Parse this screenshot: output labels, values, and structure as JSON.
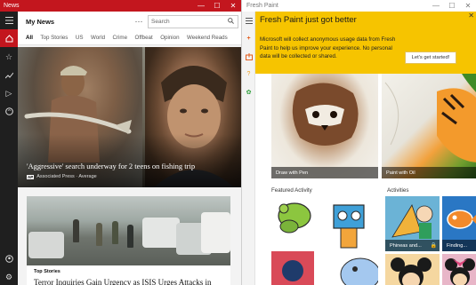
{
  "news_window": {
    "title": "News",
    "controls": {
      "minimize": "—",
      "maximize": "☐",
      "close": "✕"
    },
    "app_title": "My News",
    "more_label": "···",
    "search": {
      "placeholder": "Search",
      "icon": "search-icon"
    },
    "rail_icons": [
      "hamburger-icon",
      "home-icon",
      "star-icon",
      "trend-icon",
      "play-icon",
      "globe-icon",
      "account-icon",
      "settings-icon"
    ],
    "categories": [
      "All",
      "Top Stories",
      "US",
      "World",
      "Crime",
      "Offbeat",
      "Opinion",
      "Weekend Reads"
    ],
    "hero": {
      "headline": "'Aggressive' search underway for 2 teens on fishing trip",
      "source_logo": "AP",
      "source": "Associated Press · Average"
    },
    "story2": {
      "tag": "Top Stories",
      "headline": "Terror Inquiries Gain Urgency as ISIS Urges Attacks in"
    }
  },
  "paint_window": {
    "title": "Fresh Paint",
    "controls": {
      "minimize": "—",
      "maximize": "☐",
      "close": "✕"
    },
    "rail_icons": [
      "hamburger-icon",
      "plus-icon",
      "import-icon",
      "question-icon",
      "settings-icon"
    ],
    "accent_color": "#f6c400",
    "banner": {
      "title": "Fresh Paint just got better",
      "body": "Microsoft will collect anonymous usage data from Fresh Paint to help us improve your experience.  No personal data will be collected or shared.",
      "button": "Let's get started!",
      "close": "✕"
    },
    "cards": [
      {
        "label": "Draw with Pen"
      },
      {
        "label": "Paint with Oil"
      }
    ],
    "featured_label": "Featured Activity",
    "activities_label": "Activities",
    "activities": [
      {
        "label": "Phineas and..."
      },
      {
        "label": "Finding..."
      }
    ]
  }
}
